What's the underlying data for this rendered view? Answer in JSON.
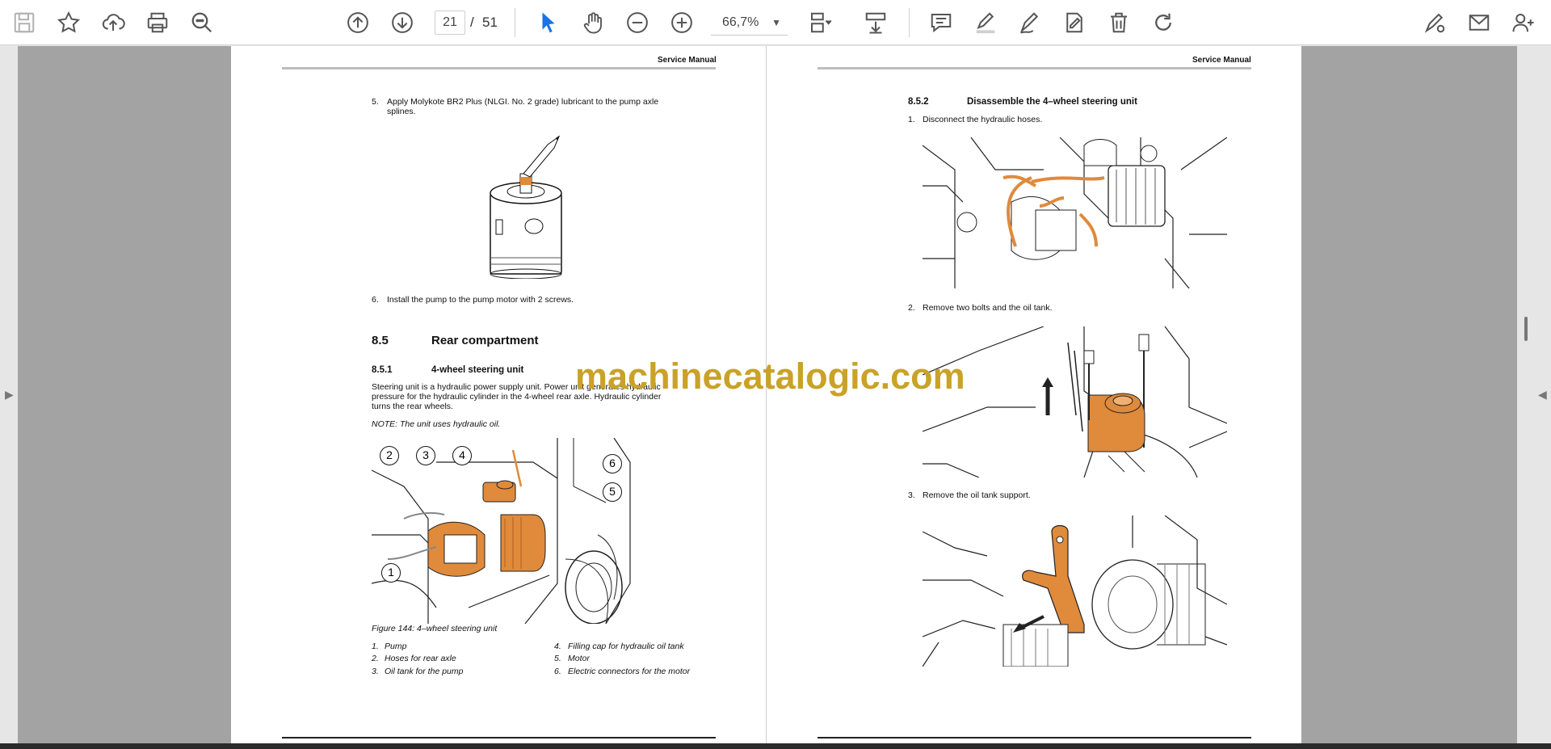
{
  "toolbar": {
    "current_page": "21",
    "page_separator": "/",
    "total_pages": "51",
    "zoom_level": "66,7%",
    "icons": [
      "save-icon",
      "bookmark-star-icon",
      "upload-icon",
      "print-icon",
      "zoom-search-icon",
      "page-up-icon",
      "page-down-icon",
      "select-cursor-icon",
      "hand-tool-icon",
      "zoom-out-icon",
      "zoom-in-icon",
      "fit-page-icon",
      "scroll-mode-icon",
      "comment-icon",
      "highlight-icon",
      "draw-icon",
      "fill-sign-icon",
      "delete-icon",
      "rotate-icon",
      "share-link-icon",
      "email-icon",
      "add-user-icon"
    ]
  },
  "colors": {
    "watermark": "#c9a227",
    "accent_blue": "#1a73e8",
    "figure_orange": "#e08a3c"
  },
  "watermark": "machinecatalogic.com",
  "left_page": {
    "header": "Service Manual",
    "step5_num": "5.",
    "step5_text_1": "Apply Molykote BR2 Plus (NLGI. No. 2 grade) lubricant to the pump axle",
    "step5_text_2": "splines.",
    "step6_num": "6.",
    "step6_text": "Install the pump to the pump motor with 2 screws.",
    "section_num": "8.5",
    "section_title": "Rear compartment",
    "subsection_num": "8.5.1",
    "subsection_title": "4-wheel steering unit",
    "para_1": "Steering unit is a hydraulic power supply unit. Power unit generates hydraulic",
    "para_2": "pressure for the hydraulic cylinder in the 4-wheel rear axle. Hydraulic cylinder",
    "para_3": "turns the rear wheels.",
    "note": "NOTE: The unit uses hydraulic oil.",
    "figure_caption": "Figure 144: 4–wheel steering unit",
    "callouts": [
      "1",
      "2",
      "3",
      "4",
      "5",
      "6"
    ],
    "legend": [
      {
        "num": "1.",
        "label": "Pump"
      },
      {
        "num": "2.",
        "label": "Hoses for rear axle"
      },
      {
        "num": "3.",
        "label": "Oil tank for the pump"
      },
      {
        "num": "4.",
        "label": "Filling cap for hydraulic oil tank"
      },
      {
        "num": "5.",
        "label": "Motor"
      },
      {
        "num": "6.",
        "label": "Electric connectors for the motor"
      }
    ]
  },
  "right_page": {
    "header": "Service Manual",
    "subsection_num": "8.5.2",
    "subsection_title": "Disassemble the 4–wheel steering unit",
    "step1_num": "1.",
    "step1_text": "Disconnect the hydraulic hoses.",
    "step2_num": "2.",
    "step2_text": "Remove two bolts and the oil tank.",
    "step3_num": "3.",
    "step3_text": "Remove the oil tank support."
  }
}
